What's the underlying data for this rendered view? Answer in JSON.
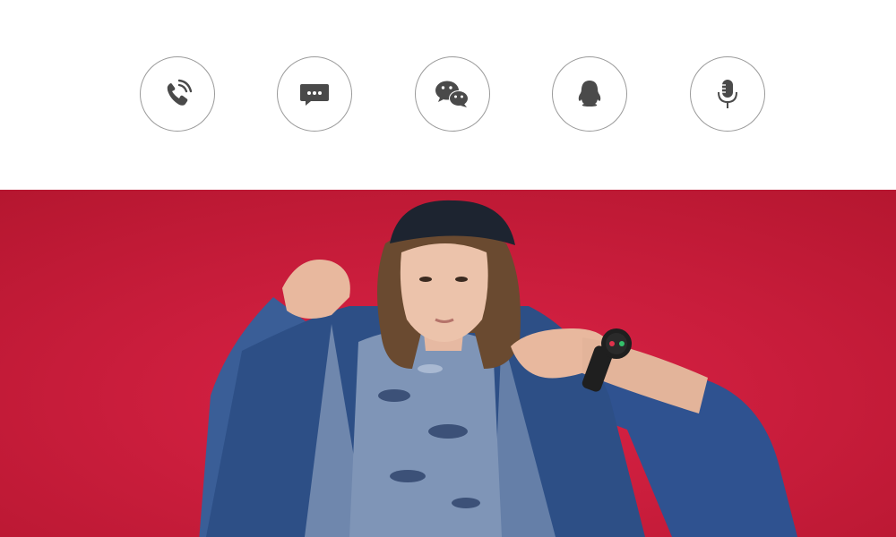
{
  "features": [
    {
      "icon": "phone-call-icon",
      "label": ""
    },
    {
      "icon": "message-icon",
      "label": ""
    },
    {
      "icon": "wechat-icon",
      "label": ""
    },
    {
      "icon": "qq-icon",
      "label": ""
    },
    {
      "icon": "microphone-icon",
      "label": ""
    }
  ],
  "banner": {
    "description": "",
    "background_color": "#c51a3b",
    "jacket_color": "#2d4f86",
    "shirt_color": "#7f95b7",
    "watch_color": "#1f1f1f"
  },
  "colors": {
    "icon_gray": "#4a4a4a",
    "border_gray": "#9a9a9a"
  }
}
